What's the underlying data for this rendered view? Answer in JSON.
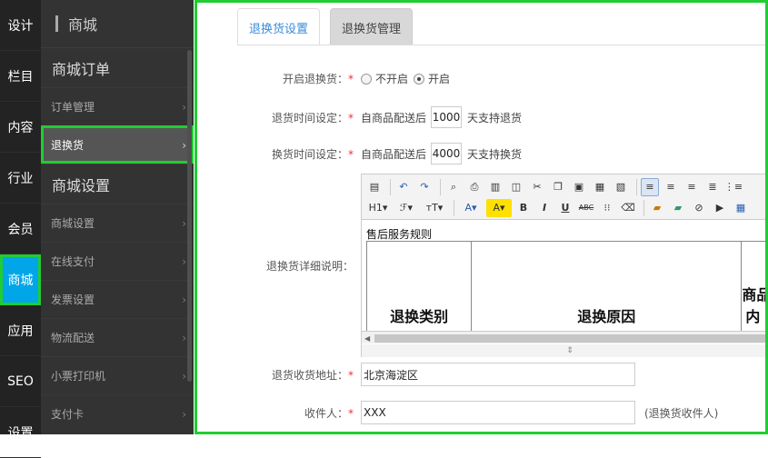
{
  "left_nav": [
    "设计",
    "栏目",
    "内容",
    "行业",
    "会员",
    "商城",
    "应用",
    "SEO",
    "设置"
  ],
  "sub_nav": {
    "title": "商城",
    "group1": "商城订单",
    "group1_items": [
      "订单管理",
      "退换货"
    ],
    "group2": "商城设置",
    "group2_items": [
      "商城设置",
      "在线支付",
      "发票设置",
      "物流配送",
      "小票打印机",
      "支付卡"
    ],
    "chevron": "›"
  },
  "tabs": [
    "退换货设置",
    "退换货管理"
  ],
  "form": {
    "enable_label": "开启退换货：",
    "enable_off": "不开启",
    "enable_on": "开启",
    "return_time_label": "退货时间设定：",
    "return_prefix": "自商品配送后",
    "return_days": "1000",
    "return_suffix": "天支持退货",
    "exchange_time_label": "换货时间设定：",
    "exchange_prefix": "自商品配送后",
    "exchange_days": "4000",
    "exchange_suffix": "天支持换货",
    "detail_label": "退换货详细说明：",
    "address_label": "退货收货地址：",
    "address_value": "北京海淀区",
    "receiver_label": "收件人：",
    "receiver_value": "XXX",
    "receiver_hint": "(退换货收件人)",
    "required_mark": "*"
  },
  "editor": {
    "caption": "售后服务规则",
    "col1": "退换类别",
    "col2": "退换原因",
    "col3_line1": "商品",
    "col3_line2": "内"
  },
  "colors": {
    "highlight": "#22cc33",
    "active_nav": "#00a6e8",
    "tab_active_text": "#3a8cd9",
    "required": "#e33"
  }
}
